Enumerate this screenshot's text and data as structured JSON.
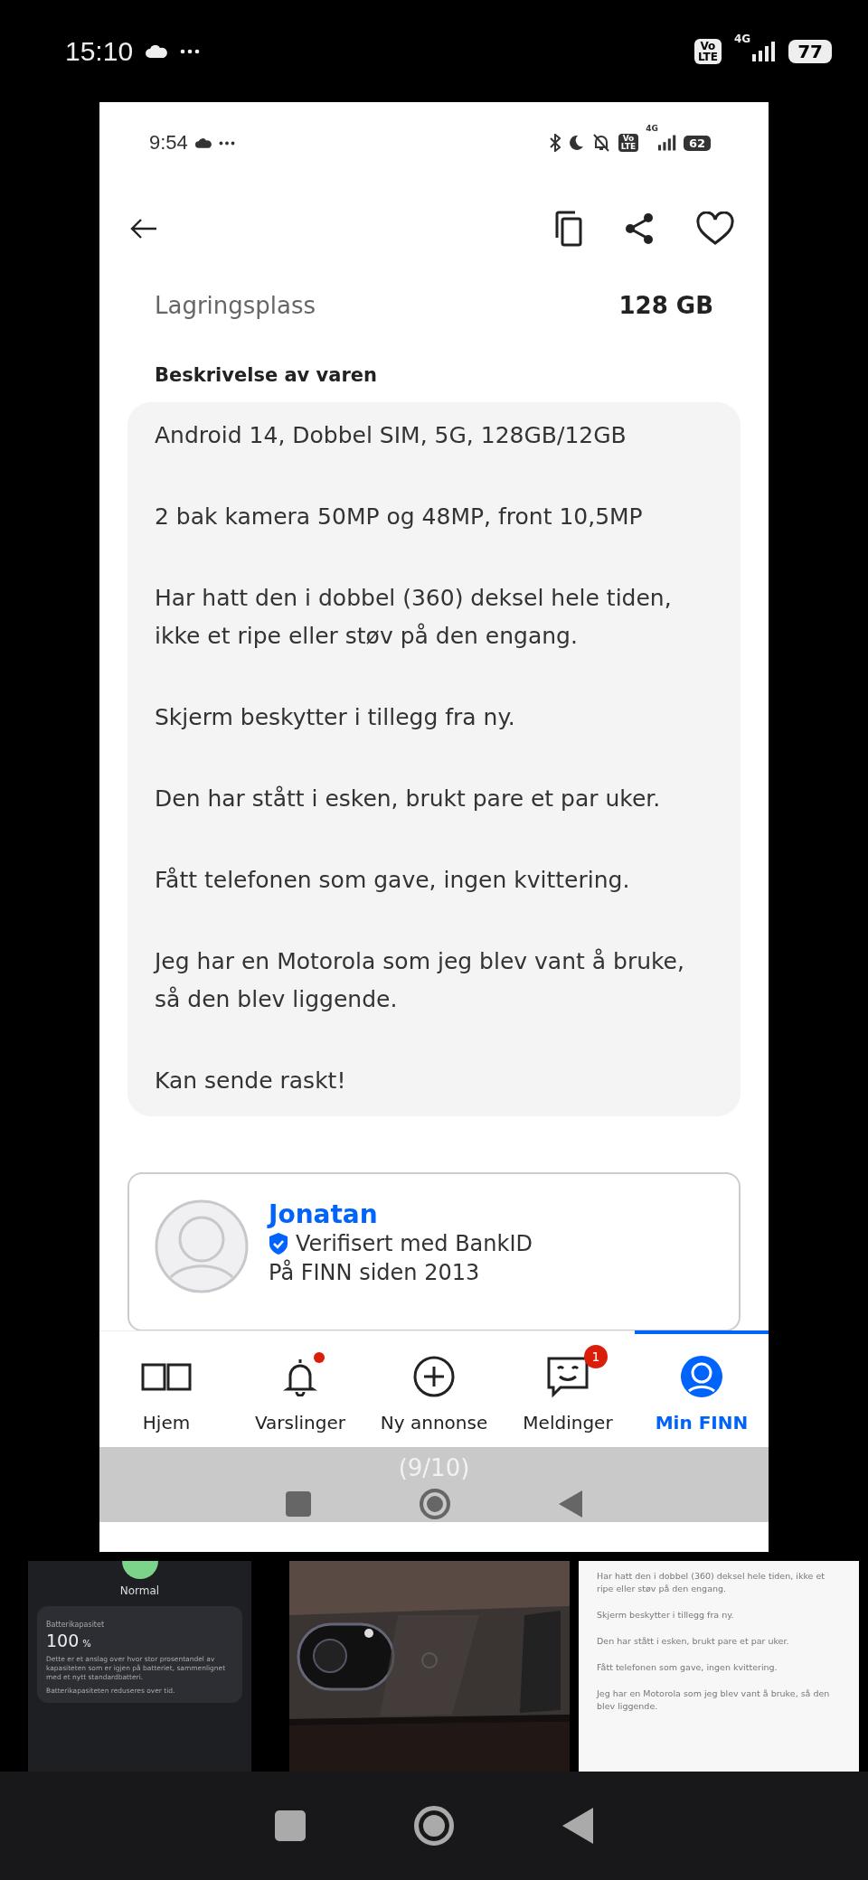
{
  "status_bar": {
    "time": "15:10",
    "volte": [
      "Vo",
      "LTE"
    ],
    "network": "4G",
    "battery": "77"
  },
  "viewer": {
    "screenshot": {
      "status_bar": {
        "time": "9:54",
        "volte": [
          "Vo",
          "LTE"
        ],
        "network": "4G",
        "battery": "62"
      },
      "spec": {
        "label": "Lagringsplass",
        "value": "128 GB"
      },
      "description": {
        "heading": "Beskrivelse av varen",
        "paragraphs": [
          "Android 14, Dobbel SIM, 5G, 128GB/12GB",
          "2 bak kamera 50MP og 48MP, front 10,5MP",
          "Har hatt den i dobbel (360) deksel hele tiden, ikke et ripe eller støv på den engang.",
          "Skjerm beskytter i tillegg fra ny.",
          "Den har stått i esken, brukt pare et par uker.",
          "Fått telefonen som gave, ingen kvittering.",
          "Jeg har en Motorola som jeg blev vant å bruke, så den blev liggende.",
          "Kan sende raskt!"
        ]
      },
      "seller": {
        "name": "Jonatan",
        "verified": "Verifisert med BankID",
        "member_since": "På FINN siden 2013"
      },
      "nav": [
        {
          "kind": "home",
          "label": "Hjem",
          "selected": false,
          "dot": false
        },
        {
          "kind": "bell",
          "label": "Varslinger",
          "selected": false,
          "dot": true
        },
        {
          "kind": "plus",
          "label": "Ny annonse",
          "selected": false,
          "dot": false
        },
        {
          "kind": "chat",
          "label": "Meldinger",
          "selected": false,
          "dot": false,
          "badge": "1"
        },
        {
          "kind": "profile",
          "label": "Min FINN",
          "selected": true,
          "dot": false
        }
      ]
    },
    "counter": "(9/10)"
  },
  "thumbnails": [
    {
      "kind": "battery",
      "status": "Normal",
      "card_title": "Batterikapasitet",
      "value": "100",
      "unit": "%",
      "text": "Dette er et anslag over hvor stor prosentandel av kapasiteten som er igjen på batteriet, sammenlignet med et nytt standardbatteri.",
      "note": "Batterikapasiteten reduseres over tid."
    },
    {
      "kind": "picture"
    },
    {
      "kind": "text",
      "paragraphs": [
        "Har hatt den i dobbel (360) deksel hele tiden, ikke et ripe eller støv på den engang.",
        "Skjerm beskytter i tillegg fra ny.",
        "Den har stått i esken, brukt pare et par uker.",
        "Fått telefonen som gave, ingen kvittering.",
        "Jeg har en Motorola som jeg blev vant å bruke, så den blev liggende."
      ]
    }
  ]
}
